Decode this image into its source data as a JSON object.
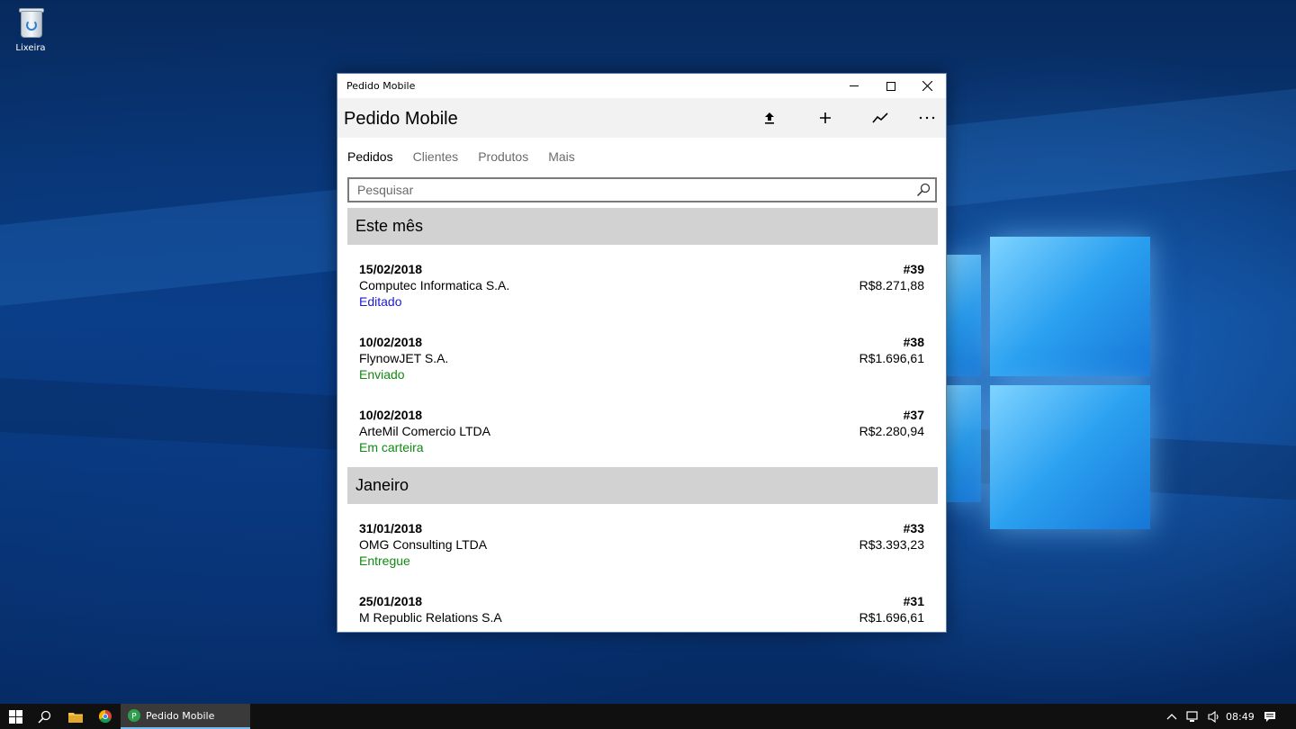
{
  "desktop": {
    "icons": [
      {
        "label": "Lixeira",
        "icon": "recycle-bin-icon"
      }
    ]
  },
  "window": {
    "title": "Pedido Mobile",
    "controls": {
      "minimize": "minimize-icon",
      "maximize": "maximize-icon",
      "close": "close-icon"
    }
  },
  "appbar": {
    "title": "Pedido Mobile",
    "actions": [
      "upload-icon",
      "add-icon",
      "chart-icon",
      "more-icon"
    ]
  },
  "tabs": [
    {
      "label": "Pedidos",
      "active": true
    },
    {
      "label": "Clientes",
      "active": false
    },
    {
      "label": "Produtos",
      "active": false
    },
    {
      "label": "Mais",
      "active": false
    }
  ],
  "search": {
    "placeholder": "Pesquisar",
    "value": ""
  },
  "groups": [
    {
      "header": "Este mês",
      "orders": [
        {
          "date": "15/02/2018",
          "number": "#39",
          "client": "Computec Informatica S.A.",
          "value": "R$8.271,88",
          "status": "Editado",
          "status_color": "#1c1cd0"
        },
        {
          "date": "10/02/2018",
          "number": "#38",
          "client": "FlynowJET S.A.",
          "value": "R$1.696,61",
          "status": "Enviado",
          "status_color": "#108a10"
        },
        {
          "date": "10/02/2018",
          "number": "#37",
          "client": "ArteMil Comercio LTDA",
          "value": "R$2.280,94",
          "status": "Em carteira",
          "status_color": "#108a10"
        }
      ]
    },
    {
      "header": "Janeiro",
      "orders": [
        {
          "date": "31/01/2018",
          "number": "#33",
          "client": "OMG Consulting LTDA",
          "value": "R$3.393,23",
          "status": "Entregue",
          "status_color": "#108a10"
        },
        {
          "date": "25/01/2018",
          "number": "#31",
          "client": "M Republic Relations S.A",
          "value": "R$1.696,61",
          "status": "",
          "status_color": "#108a10"
        }
      ]
    }
  ],
  "taskbar": {
    "app_label": "Pedido Mobile",
    "clock": "08:49",
    "accent": "#76b9ed"
  }
}
